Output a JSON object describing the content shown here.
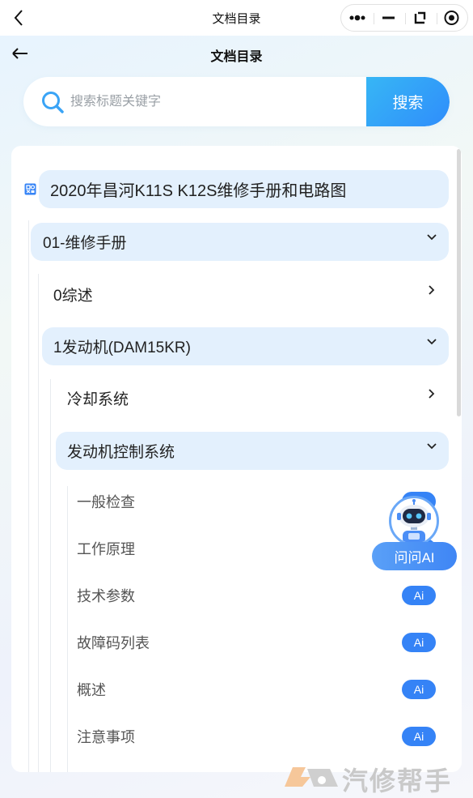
{
  "miniprogram_bar": {
    "title": "文档目录"
  },
  "header": {
    "title": "文档目录"
  },
  "search": {
    "placeholder": "搜索标题关键字",
    "button_label": "搜索"
  },
  "tree": {
    "root": {
      "label": "2020年昌河K11S K12S维修手册和电路图"
    },
    "items": [
      {
        "label": "01-维修手册",
        "state": "expanded"
      },
      {
        "label": "0综述",
        "state": "collapsed"
      },
      {
        "label": "1发动机(DAM15KR)",
        "state": "expanded"
      },
      {
        "label": "冷却系统",
        "state": "collapsed"
      },
      {
        "label": "发动机控制系统",
        "state": "expanded"
      }
    ],
    "leaves": [
      {
        "label": "一般检查",
        "ai": "Ai"
      },
      {
        "label": "工作原理",
        "ai": "Ai"
      },
      {
        "label": "技术参数",
        "ai": "Ai"
      },
      {
        "label": "故障码列表",
        "ai": "Ai"
      },
      {
        "label": "概述",
        "ai": "Ai"
      },
      {
        "label": "注意事项",
        "ai": "Ai"
      }
    ]
  },
  "ai_assistant": {
    "label": "问问AI"
  },
  "watermark": {
    "text": "汽修帮手"
  },
  "colors": {
    "accent": "#3583f6",
    "highlight": "#e3f0fd",
    "search_button": "#2f8dfb"
  }
}
